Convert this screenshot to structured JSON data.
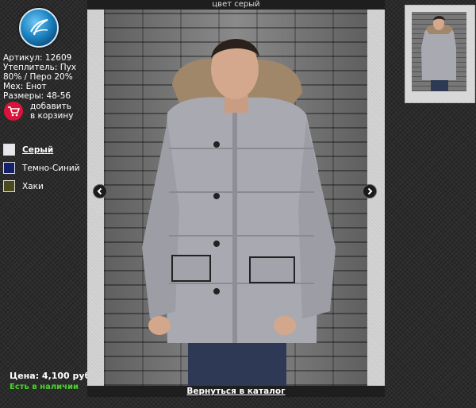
{
  "colors_accent": {
    "price_stock": "#4bd12b",
    "cart": "#d9143a"
  },
  "product": {
    "article": "Артикул: 12609",
    "insulation_1": "Утеплитель: Пух",
    "insulation_2": "80% / Перо 20%",
    "fur": "Мех: Енот",
    "sizes": "Размеры: 48-56"
  },
  "cart": {
    "label": "добавить в корзину",
    "icon": "shopping-cart-icon"
  },
  "colors": [
    {
      "label": "Серый",
      "swatch": "#e6e6ec",
      "active": true
    },
    {
      "label": "Темно-Синий",
      "swatch": "#14206a",
      "active": false
    },
    {
      "label": "Хаки",
      "swatch": "#4a4a1c",
      "active": false
    }
  ],
  "price": "Цена: 4,100 руб.",
  "stock": "Есть в наличии",
  "viewer": {
    "caption": "цвет серый",
    "back_link": "Вернуться в каталог"
  }
}
